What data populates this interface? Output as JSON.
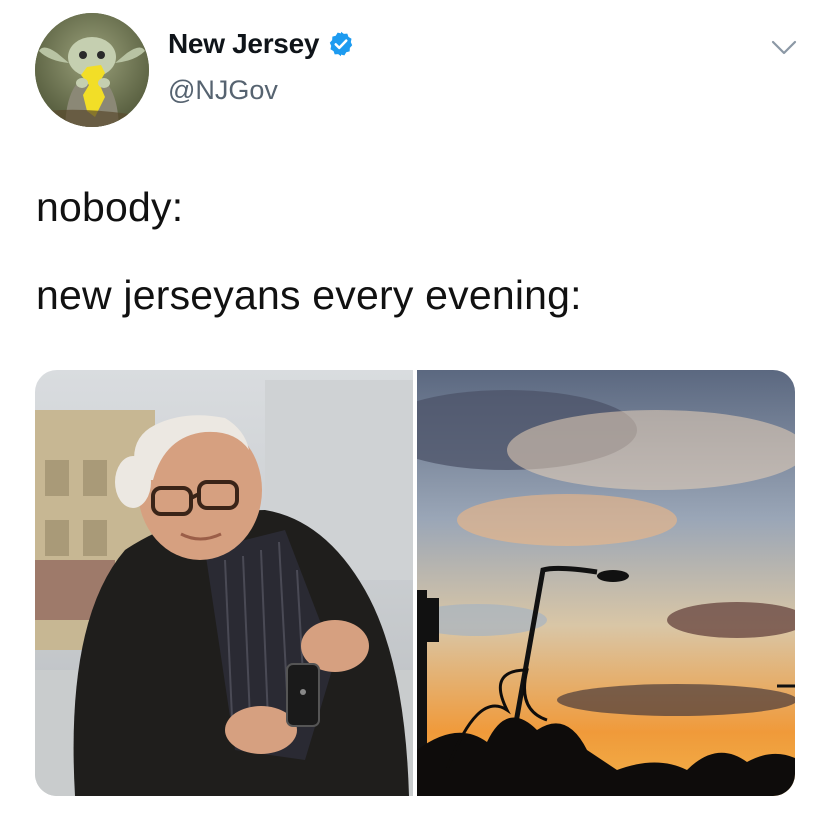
{
  "tweet": {
    "display_name": "New Jersey",
    "handle": "@NJGov",
    "verified_icon": "verified-badge-icon",
    "menu_icon": "chevron-down-icon",
    "lines": [
      "nobody:",
      "new jerseyans every evening:"
    ]
  },
  "colors": {
    "verified": "#1d9bf0",
    "handle": "#566370",
    "text": "#111111"
  }
}
